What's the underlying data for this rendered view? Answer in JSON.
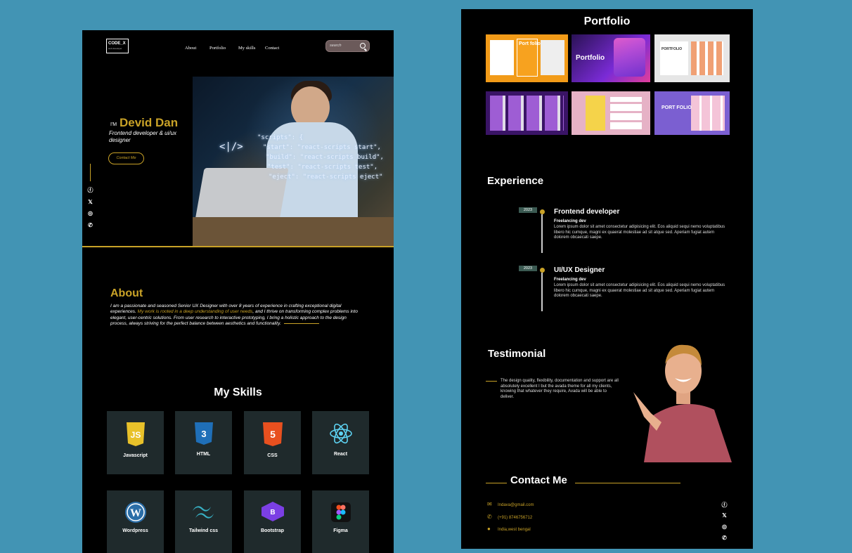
{
  "left_page": {
    "logo": {
      "text": "CODE_X",
      "sub": "web developer"
    },
    "nav": [
      "About",
      "Portfolio",
      "My skills",
      "Contact"
    ],
    "search": {
      "placeholder": "search"
    },
    "hero": {
      "prefix": "I'M",
      "name": "Devid Dan",
      "subtitle": "Frontend developer & ui/ux designer",
      "button": "Contact Me",
      "code_lines": [
        "<|/>",
        "\"scripts\": {",
        "\"start\": \"react-scripts start\",",
        "\"build\": \"react-scripts build\",",
        "\"test\": \"react-scripts test\",",
        "\"eject\": \"react-scripts eject\""
      ]
    },
    "social_icons": [
      "facebook-icon",
      "x-icon",
      "instagram-icon",
      "whatsapp-icon"
    ],
    "about": {
      "title": "About",
      "text_a": "I am a passionate and seasoned Senior UX Designer with over 8 years of experience in crafting exceptional digital experiences. ",
      "text_hl": "My work is rooted in a deep understanding of user needs",
      "text_b": ", and I thrive on transforming complex problems into elegant, user-centric solutions. From user research to interactive prototyping, I bring a holistic approach to the design process, always striving for the perfect balance between aesthetics and functionality."
    },
    "skills": {
      "title": "My Skills",
      "items": [
        "Javascript",
        "HTML",
        "CSS",
        "React",
        "Wordpress",
        "Tailwind css",
        "Bootstrap",
        "Figma"
      ],
      "colors": {
        "js": "#e8c12a",
        "html": "#1f6fb8",
        "css": "#e8501f",
        "react": "#5ed3f3",
        "wp": "#2b6ea8",
        "tailwind": "#38b2c6",
        "bootstrap": "#7b3fe4",
        "figma": "#f24e1e"
      }
    }
  },
  "right_page": {
    "portfolio": {
      "title": "Portfolio",
      "thumb_labels": [
        "Port folio",
        "Portfolio",
        "PORTFOLIO",
        "",
        "",
        "PORT FOLIO"
      ]
    },
    "experience": {
      "title": "Experience",
      "items": [
        {
          "year": "2023",
          "title": "Frontend developer",
          "company": "Freelancing dev",
          "desc": "Lorem ipsum dolor sit amet consectetur adipisicing elit. Eos aliquid sequi nemo voluptatibus libero hic cumque, magni ex quaerat molestiae ad sit atque sed. Aperiam fugiat autem dolorem obcaecati saepe."
        },
        {
          "year": "2023",
          "title": "UI/UX Designer",
          "company": "Freelancing dev",
          "desc": "Lorem ipsum dolor sit amet consectetur adipisicing elit. Eos aliquid sequi nemo voluptatibus libero hic cumque, magni ex quaerat molestiae ad sit atque sed. Aperiam fugiat autem dolorem obcaecati saepe."
        }
      ]
    },
    "testimonial": {
      "title": "Testimonial",
      "text": "The design quality, flexibility, documentation and support are all absolutely excellent I but the avada theme for all my clients, knowing that whatever they require, Avada will be able to deliver."
    },
    "contact": {
      "title": "Contact Me",
      "email": "Indava@gmail.com",
      "phone": "(+91) 8746756712",
      "location": "India,west bengal"
    }
  },
  "colors": {
    "accent": "#c9a227",
    "background": "#4294b4",
    "panel": "#000000",
    "card": "#1f2a2c"
  }
}
